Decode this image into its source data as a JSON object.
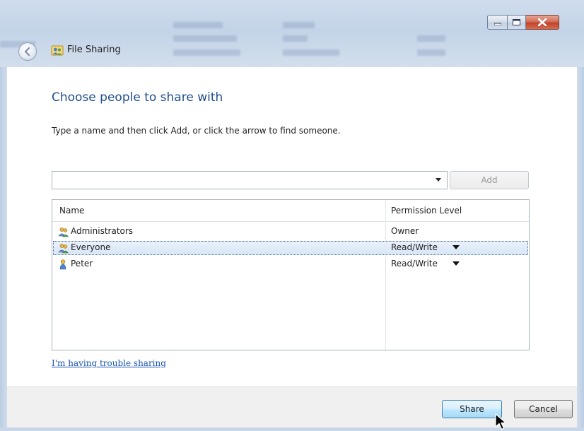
{
  "window": {
    "title": "File Sharing",
    "icons": {
      "back": "back-arrow-icon",
      "title": "file-sharing-icon",
      "minimize": "minimize-icon",
      "maximize": "maximize-icon",
      "close": "close-icon"
    },
    "colors": {
      "close_button": "#c0432b",
      "heading": "#1f4e8c",
      "link": "#1a55b0"
    }
  },
  "main": {
    "heading": "Choose people to share with",
    "instruction": "Type a name and then click Add, or click the arrow to find someone.",
    "name_input": {
      "value": "",
      "placeholder": ""
    },
    "add_button": "Add",
    "table": {
      "columns": [
        "Name",
        "Permission Level"
      ],
      "rows": [
        {
          "name": "Administrators",
          "permission": "Owner",
          "icon": "group-users-icon",
          "has_dropdown": false,
          "selected": false
        },
        {
          "name": "Everyone",
          "permission": "Read/Write",
          "icon": "group-users-icon",
          "has_dropdown": true,
          "selected": true
        },
        {
          "name": "Peter",
          "permission": "Read/Write",
          "icon": "single-user-icon",
          "has_dropdown": true,
          "selected": false
        }
      ]
    },
    "help_link": "I'm having trouble sharing"
  },
  "footer": {
    "share_button": "Share",
    "cancel_button": "Cancel"
  }
}
